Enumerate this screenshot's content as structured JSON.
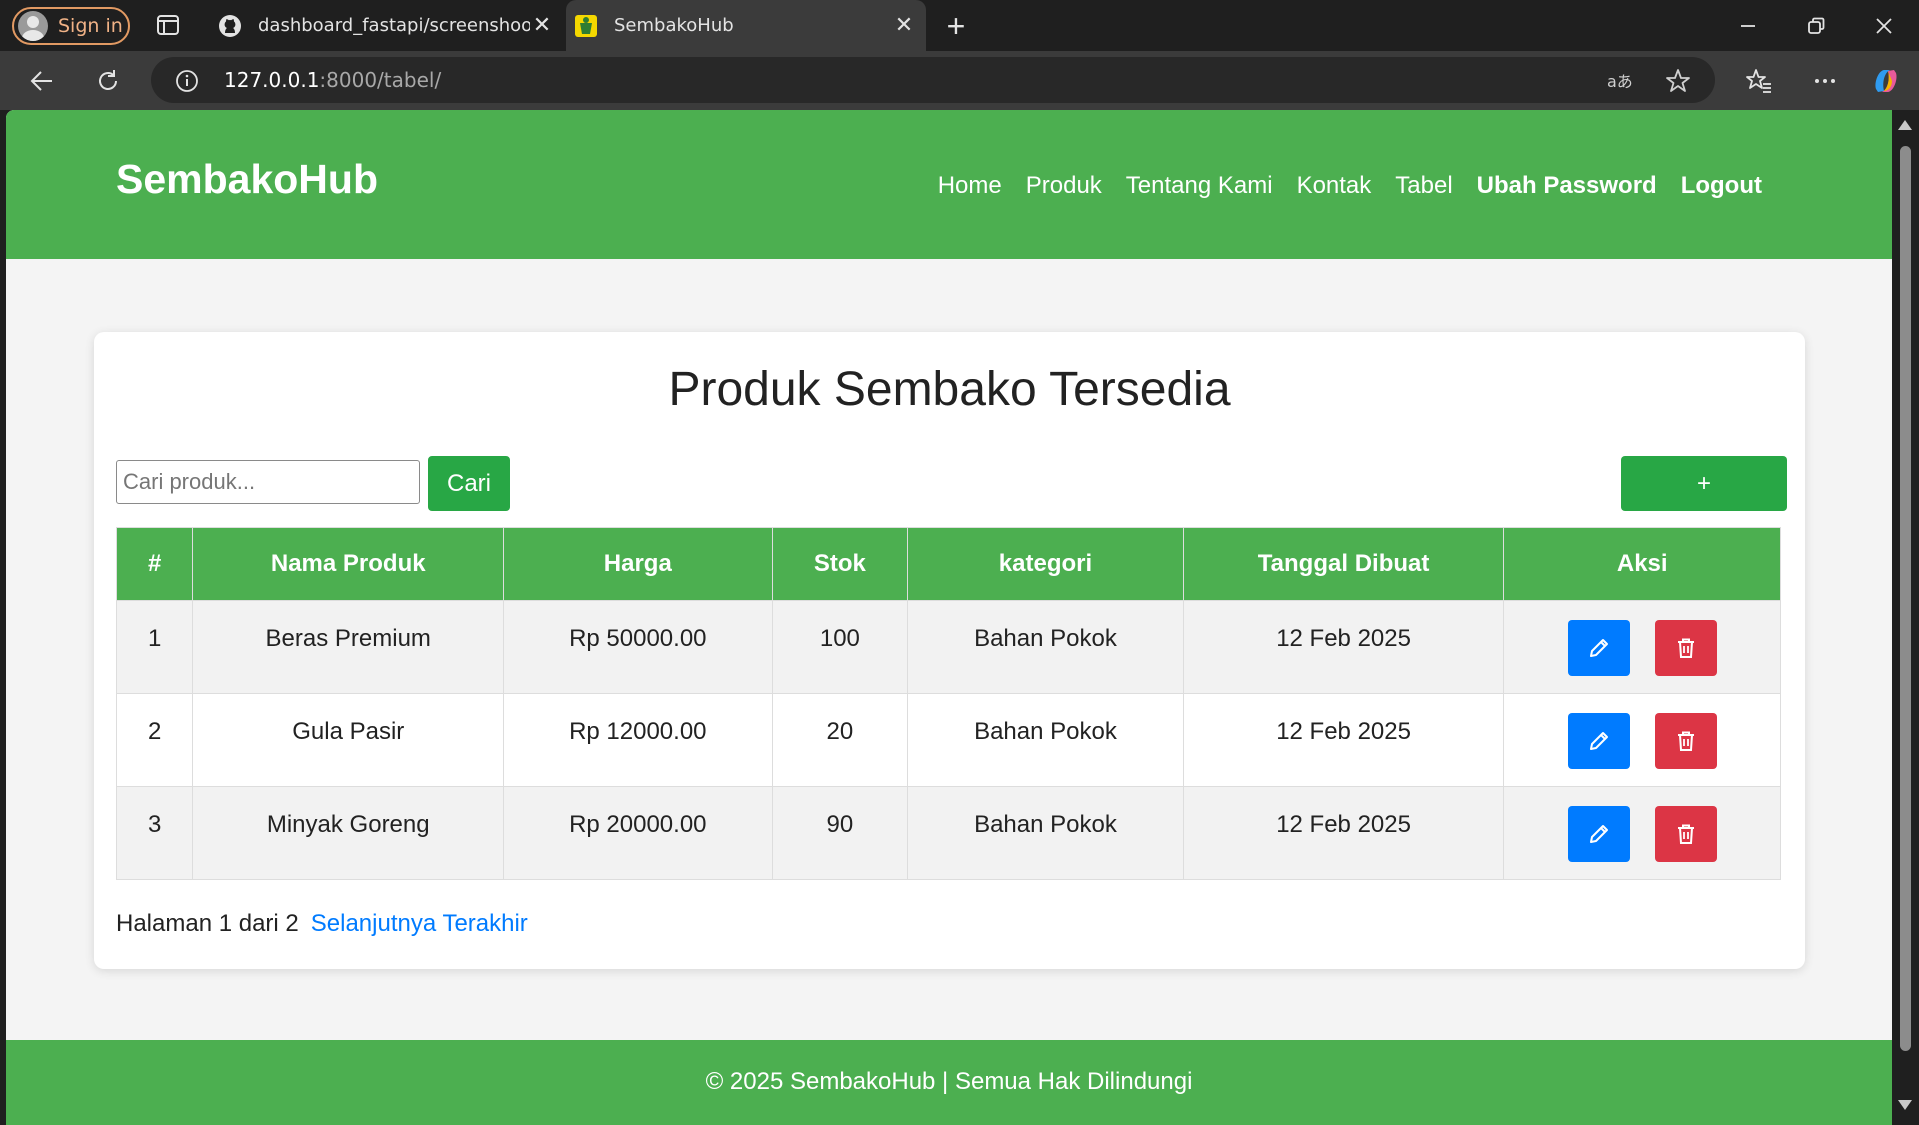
{
  "browser": {
    "signin_label": "Sign in",
    "tabs": [
      {
        "title": "dashboard_fastapi/screenshoots/",
        "icon": "github-icon"
      },
      {
        "title": "SembakoHub",
        "icon": "sembakohub-favicon"
      }
    ],
    "address": {
      "host": "127.0.0.1",
      "path": ":8000/tabel/"
    }
  },
  "site": {
    "brand": "SembakoHub",
    "nav": [
      "Home",
      "Produk",
      "Tentang Kami",
      "Kontak",
      "Tabel",
      "Ubah Password",
      "Logout"
    ],
    "colors": {
      "primary": "#4caf50",
      "success": "#28a745",
      "edit": "#007bff",
      "delete": "#dc3545"
    }
  },
  "main": {
    "title": "Produk Sembako Tersedia",
    "search_placeholder": "Cari produk...",
    "search_button": "Cari",
    "add_button": "+",
    "table": {
      "headers": [
        "#",
        "Nama Produk",
        "Harga",
        "Stok",
        "kategori",
        "Tanggal Dibuat",
        "Aksi"
      ],
      "rows": [
        [
          "1",
          "Beras Premium",
          "Rp 50000.00",
          "100",
          "Bahan Pokok",
          "12 Feb 2025"
        ],
        [
          "2",
          "Gula Pasir",
          "Rp 12000.00",
          "20",
          "Bahan Pokok",
          "12 Feb 2025"
        ],
        [
          "3",
          "Minyak Goreng",
          "Rp 20000.00",
          "90",
          "Bahan Pokok",
          "12 Feb 2025"
        ]
      ]
    },
    "pagination": {
      "info": "Halaman 1 dari 2",
      "next": "Selanjutnya",
      "last": "Terakhir"
    }
  },
  "footer": {
    "text": "© 2025 SembakoHub | Semua Hak Dilindungi"
  }
}
